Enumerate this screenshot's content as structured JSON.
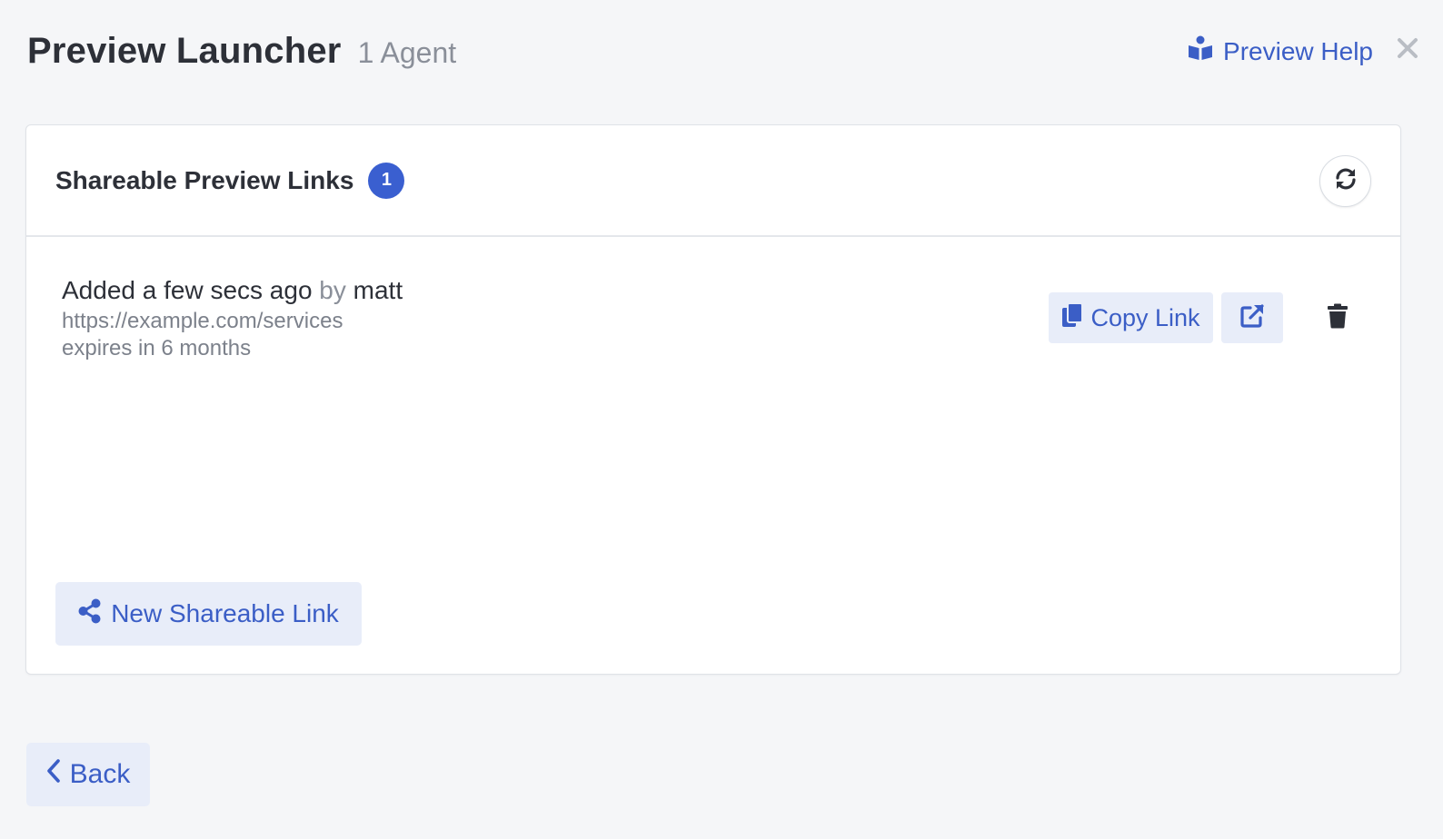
{
  "header": {
    "title": "Preview Launcher",
    "subtitle": "1 Agent",
    "help_label": "Preview Help",
    "help_icon": "book-reader-icon",
    "close_icon": "close-icon"
  },
  "card": {
    "title": "Shareable Preview Links",
    "count": "1",
    "refresh_icon": "refresh-icon",
    "links": [
      {
        "added": "Added a few secs ago",
        "by": "by",
        "user": "matt",
        "url": "https://example.com/services",
        "expires": "expires in 6 months",
        "copy_label": "Copy Link",
        "copy_icon": "copy-icon",
        "open_icon": "external-link-icon",
        "delete_icon": "trash-icon"
      }
    ],
    "new_link_label": "New Shareable Link",
    "new_link_icon": "share-icon"
  },
  "footer": {
    "back_label": "Back",
    "back_icon": "chevron-left-icon"
  },
  "colors": {
    "accent": "#3b5ec6",
    "badge": "#3a5fd0",
    "button_bg": "#e8edf9",
    "page_bg": "#f5f6f8",
    "muted_text": "#8a8f99"
  }
}
